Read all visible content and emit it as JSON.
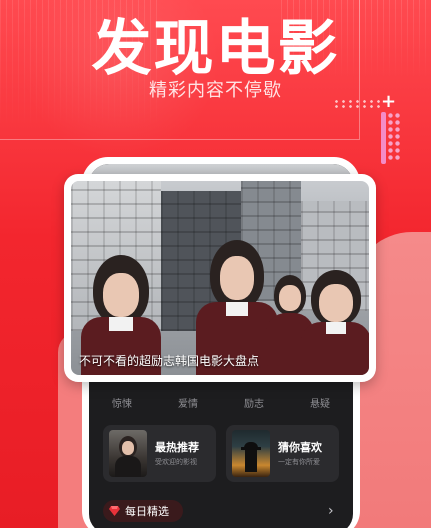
{
  "header": {
    "title": "发现电影",
    "subtitle": "精彩内容不停歇"
  },
  "featured_video": {
    "caption": "不可不看的超励志韩国电影大盘点"
  },
  "category_tabs": [
    {
      "label": "惊悚"
    },
    {
      "label": "爱情"
    },
    {
      "label": "励志"
    },
    {
      "label": "悬疑"
    }
  ],
  "recommend_cards": [
    {
      "title": "最热推荐",
      "desc": "受欢迎的影视"
    },
    {
      "title": "猜你喜欢",
      "desc": "一定有你所爱"
    }
  ],
  "daily": {
    "label": "每日精选"
  },
  "colors": {
    "brand_red": "#f3262e",
    "accent_pink": "#f48cc7",
    "screen_dark": "#1d1d1f"
  },
  "icons": {
    "daily_icon": "gem-icon",
    "more_icon": "chevron-right-icon",
    "decor_plus": "plus-icon"
  }
}
